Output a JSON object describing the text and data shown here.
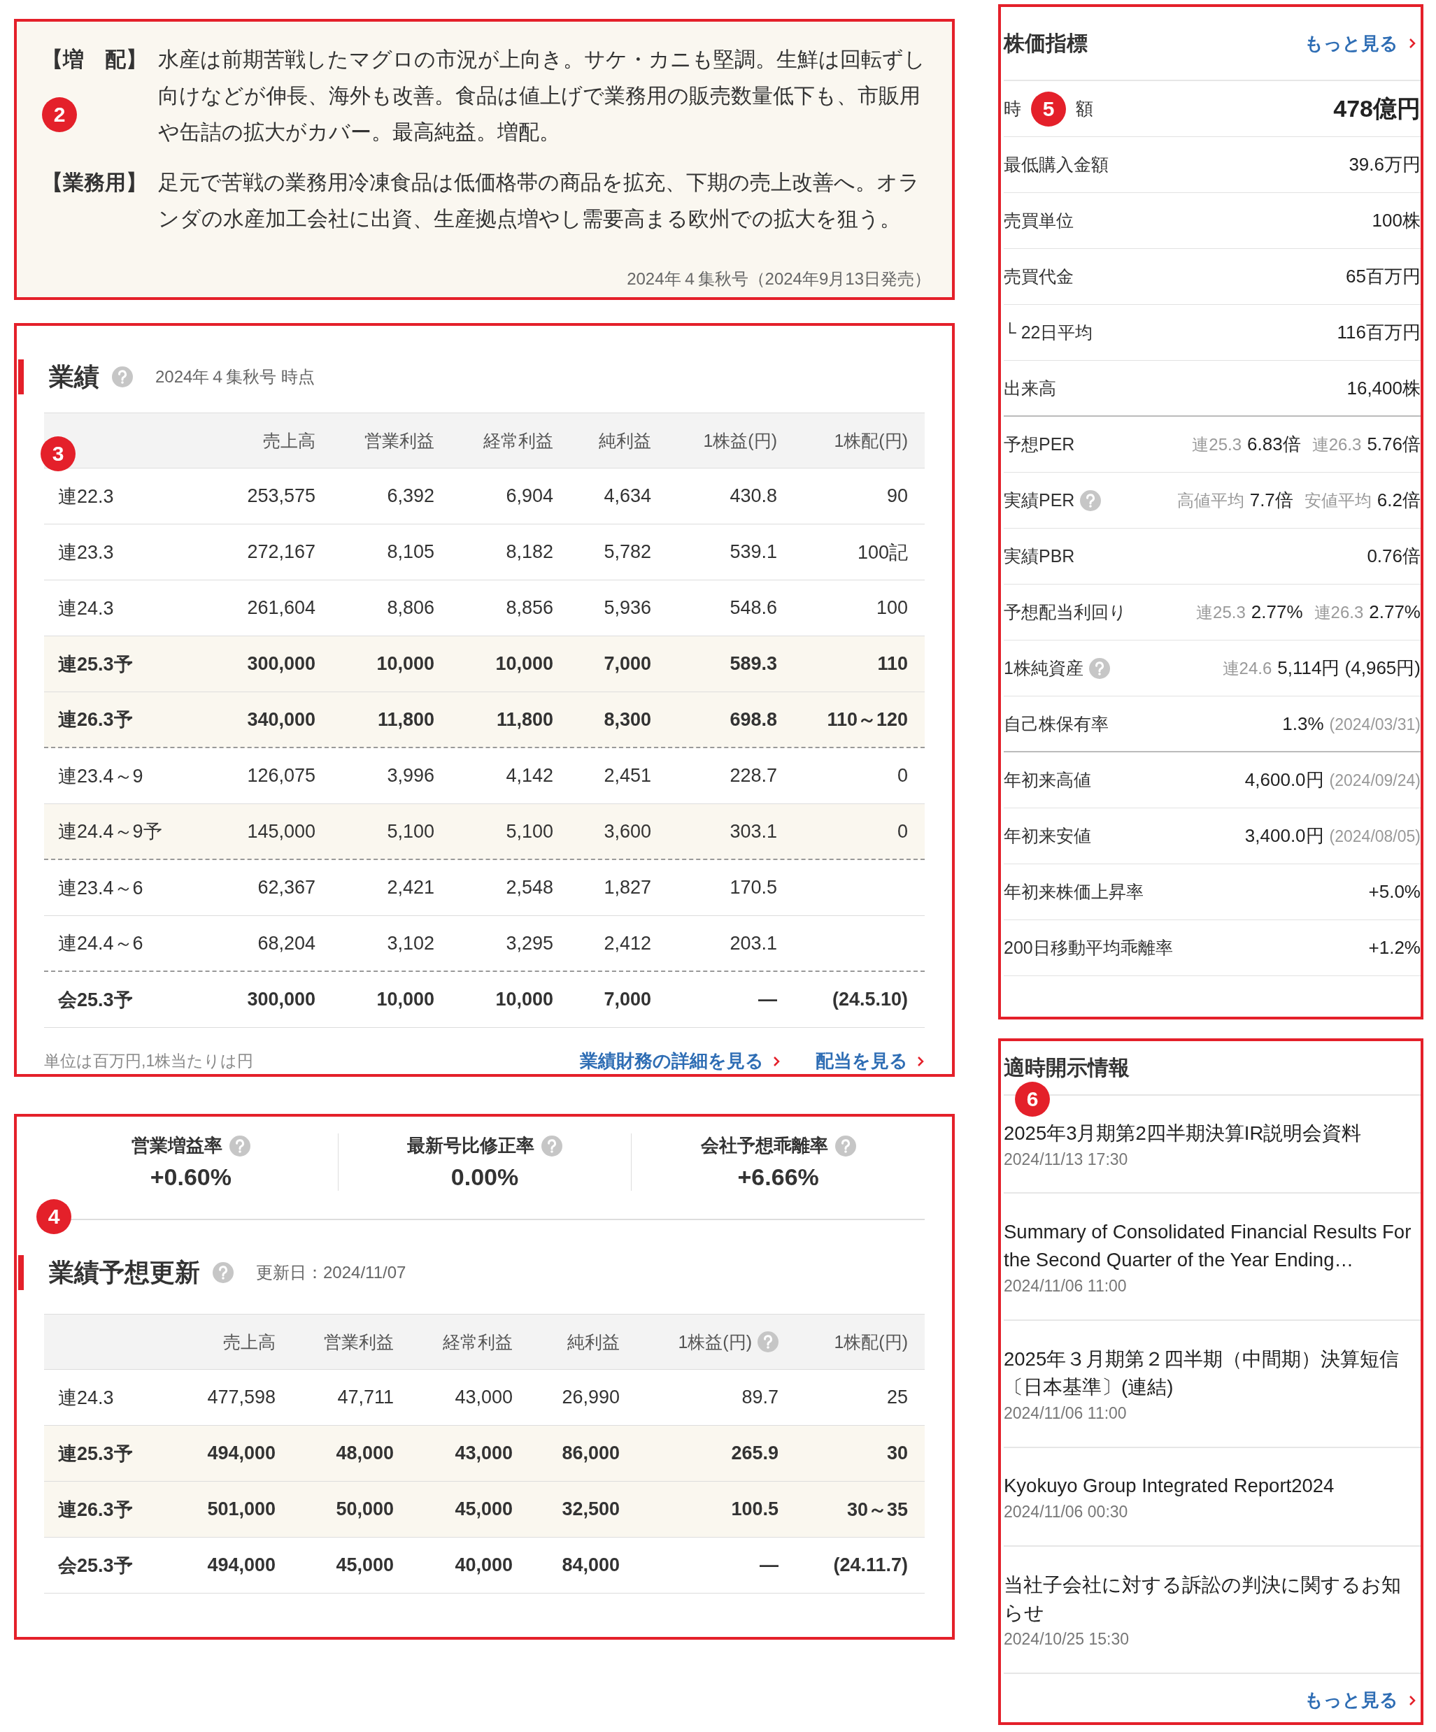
{
  "summary": {
    "marker": "2",
    "paragraphs": [
      {
        "heading": "【増　配】",
        "text": "水産は前期苦戦したマグロの市況が上向き。サケ・カニも堅調。生鮮は回転ずし向けなどが伸長、海外も改善。食品は値上げで業務用の販売数量低下も、市販用や缶詰の拡大がカバー。最高純益。増配。"
      },
      {
        "heading": "【業務用】",
        "text": "足元で苦戦の業務用冷凍食品は低価格帯の商品を拡充、下期の売上改善へ。オランダの水産加工会社に出資、生産拠点増やし需要高まる欧州での拡大を狙う。"
      }
    ],
    "source": "2024年４集秋号（2024年9月13日発売）"
  },
  "results": {
    "marker": "3",
    "title": "業績",
    "help": true,
    "note": "2024年４集秋号 時点",
    "columns": [
      {
        "label": "売上高"
      },
      {
        "label": "営業利益"
      },
      {
        "label": "経常利益"
      },
      {
        "label": "純利益"
      },
      {
        "label": "1株益(円)"
      },
      {
        "label": "1株配(円)"
      }
    ],
    "rows": [
      {
        "label": "連22.3",
        "values": [
          "253,575",
          "6,392",
          "6,904",
          "4,634",
          "430.8",
          "90"
        ],
        "bold": false,
        "highlighted": false,
        "dashed_below": false
      },
      {
        "label": "連23.3",
        "values": [
          "272,167",
          "8,105",
          "8,182",
          "5,782",
          "539.1",
          "100記"
        ],
        "bold": false,
        "highlighted": false,
        "dashed_below": false
      },
      {
        "label": "連24.3",
        "values": [
          "261,604",
          "8,806",
          "8,856",
          "5,936",
          "548.6",
          "100"
        ],
        "bold": false,
        "highlighted": false,
        "dashed_below": false
      },
      {
        "label": "連25.3予",
        "values": [
          "300,000",
          "10,000",
          "10,000",
          "7,000",
          "589.3",
          "110"
        ],
        "bold": true,
        "highlighted": true,
        "dashed_below": false
      },
      {
        "label": "連26.3予",
        "values": [
          "340,000",
          "11,800",
          "11,800",
          "8,300",
          "698.8",
          "110～120"
        ],
        "bold": true,
        "highlighted": true,
        "dashed_below": true
      },
      {
        "label": "連23.4～9",
        "values": [
          "126,075",
          "3,996",
          "4,142",
          "2,451",
          "228.7",
          "0"
        ],
        "bold": false,
        "highlighted": false,
        "dashed_below": false
      },
      {
        "label": "連24.4～9予",
        "values": [
          "145,000",
          "5,100",
          "5,100",
          "3,600",
          "303.1",
          "0"
        ],
        "bold": false,
        "highlighted": true,
        "dashed_below": true
      },
      {
        "label": "連23.4～6",
        "values": [
          "62,367",
          "2,421",
          "2,548",
          "1,827",
          "170.5"
        ],
        "bold": false,
        "highlighted": false,
        "dashed_below": false
      },
      {
        "label": "連24.4～6",
        "values": [
          "68,204",
          "3,102",
          "3,295",
          "2,412",
          "203.1"
        ],
        "bold": false,
        "highlighted": false,
        "dashed_below": true
      },
      {
        "label": "会25.3予",
        "values": [
          "300,000",
          "10,000",
          "10,000",
          "7,000",
          "—",
          "(24.5.10)"
        ],
        "bold": true,
        "highlighted": false,
        "dashed_below": false
      }
    ],
    "footnote": "単位は百万円,1株当たりは円",
    "links": [
      "業績財務の詳細を見る",
      "配当を見る"
    ]
  },
  "forecast": {
    "marker": "4",
    "rates": [
      {
        "label": "営業増益率",
        "value": "+0.60%",
        "help": true
      },
      {
        "label": "最新号比修正率",
        "value": "0.00%",
        "help": true
      },
      {
        "label": "会社予想乖離率",
        "value": "+6.66%",
        "help": true
      }
    ],
    "title": "業績予想更新",
    "help": true,
    "updated": "更新日：2024/11/07",
    "columns": [
      {
        "label": "売上高"
      },
      {
        "label": "営業利益"
      },
      {
        "label": "経常利益"
      },
      {
        "label": "純利益"
      },
      {
        "label": "1株益(円)",
        "help": true
      },
      {
        "label": "1株配(円)"
      }
    ],
    "rows": [
      {
        "label": "連24.3",
        "values": [
          "477,598",
          "47,711",
          "43,000",
          "26,990",
          "89.7",
          "25"
        ],
        "bold": false,
        "highlighted": false,
        "dashed_below": false
      },
      {
        "label": "連25.3予",
        "values": [
          "494,000",
          "48,000",
          "43,000",
          "86,000",
          "265.9",
          "30"
        ],
        "bold": true,
        "highlighted": true,
        "dashed_below": false
      },
      {
        "label": "連26.3予",
        "values": [
          "501,000",
          "50,000",
          "45,000",
          "32,500",
          "100.5",
          "30～35"
        ],
        "bold": true,
        "highlighted": true,
        "dashed_below": false
      },
      {
        "label": "会25.3予",
        "values": [
          "494,000",
          "45,000",
          "40,000",
          "84,000",
          "—",
          "(24.11.7)"
        ],
        "bold": true,
        "highlighted": false,
        "dashed_below": false
      }
    ]
  },
  "indicators": {
    "marker": "5",
    "title": "株価指標",
    "more": "もっと見る",
    "rows": [
      {
        "label": "時",
        "label_tail": "額",
        "big": true,
        "items": [
          {
            "value": "478億円"
          }
        ]
      },
      {
        "label": "最低購入金額",
        "items": [
          {
            "value": "39.6万円"
          }
        ]
      },
      {
        "label": "売買単位",
        "items": [
          {
            "value": "100株"
          }
        ]
      },
      {
        "label": "売買代金",
        "items": [
          {
            "value": "65百万円"
          }
        ]
      },
      {
        "label": "└ 22日平均",
        "items": [
          {
            "value": "116百万円"
          }
        ]
      },
      {
        "label": "出来高",
        "group_end": true,
        "items": [
          {
            "value": "16,400株"
          }
        ]
      },
      {
        "label": "予想PER",
        "items": [
          {
            "sub": "連25.3",
            "value": "6.83倍"
          },
          {
            "sub": "連26.3",
            "value": "5.76倍"
          }
        ]
      },
      {
        "label": "実績PER",
        "help": true,
        "items": [
          {
            "sub": "高値平均",
            "value": "7.7倍"
          },
          {
            "sub": "安値平均",
            "value": "6.2倍"
          }
        ]
      },
      {
        "label": "実績PBR",
        "items": [
          {
            "value": "0.76倍"
          }
        ]
      },
      {
        "label": "予想配当利回り",
        "items": [
          {
            "sub": "連25.3",
            "value": "2.77%"
          },
          {
            "sub": "連26.3",
            "value": "2.77%"
          }
        ]
      },
      {
        "label": "1株純資産",
        "help": true,
        "items": [
          {
            "sub": "連24.6",
            "value": "5,114円 (4,965円)"
          }
        ]
      },
      {
        "label": "自己株保有率",
        "group_end": true,
        "items": [
          {
            "value": "1.3%",
            "note": "(2024/03/31)"
          }
        ]
      },
      {
        "label": "年初来高値",
        "items": [
          {
            "value": "4,600.0円",
            "note": "(2024/09/24)"
          }
        ]
      },
      {
        "label": "年初来安値",
        "items": [
          {
            "value": "3,400.0円",
            "note": "(2024/08/05)"
          }
        ]
      },
      {
        "label": "年初来株価上昇率",
        "items": [
          {
            "value": "+5.0%"
          }
        ]
      },
      {
        "label": "200日移動平均乖離率",
        "items": [
          {
            "value": "+1.2%"
          }
        ]
      }
    ]
  },
  "disclosures": {
    "marker": "6",
    "title": "適時開示情報",
    "items": [
      {
        "title": "2025年3月期第2四半期決算IR説明会資料",
        "date": "2024/11/13 17:30"
      },
      {
        "title": "Summary of Consolidated Financial Results For the Second Quarter of the Year Ending…",
        "date": "2024/11/06 11:00"
      },
      {
        "title": "2025年３月期第２四半期（中間期）決算短信〔日本基準〕(連結)",
        "date": "2024/11/06 11:00"
      },
      {
        "title": "Kyokuyo Group Integrated Report2024",
        "date": "2024/11/06 00:30"
      },
      {
        "title": "当社子会社に対する訴訟の判決に関するお知らせ",
        "date": "2024/10/25 15:30"
      }
    ],
    "more": "もっと見る"
  }
}
